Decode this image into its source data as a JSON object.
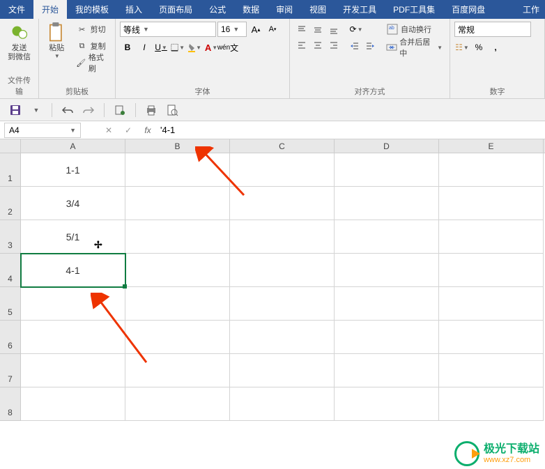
{
  "title": "工作",
  "menu": {
    "items": [
      "文件",
      "开始",
      "我的模板",
      "插入",
      "页面布局",
      "公式",
      "数据",
      "审阅",
      "视图",
      "开发工具",
      "PDF工具集",
      "百度网盘"
    ],
    "active_index": 1
  },
  "ribbon": {
    "group1": {
      "send_wechat": "发送\n到微信",
      "file_transfer": "文件传输"
    },
    "clipboard": {
      "paste": "粘贴",
      "cut": "剪切",
      "copy": "复制",
      "format_painter": "格式刷",
      "label": "剪贴板"
    },
    "font": {
      "name": "等线",
      "size": "16",
      "bold": "B",
      "italic": "I",
      "underline": "U",
      "label": "字体"
    },
    "alignment": {
      "wrap": "自动换行",
      "merge": "合并后居中",
      "label": "对齐方式"
    },
    "number": {
      "format": "常规",
      "label": "数字"
    }
  },
  "qat": {
    "save": "save"
  },
  "formula_bar": {
    "name_box": "A4",
    "formula": "'4-1"
  },
  "columns": [
    "A",
    "B",
    "C",
    "D",
    "E"
  ],
  "rows": [
    {
      "num": "1",
      "cells": [
        "1-1",
        "",
        "",
        "",
        ""
      ]
    },
    {
      "num": "2",
      "cells": [
        "3/4",
        "",
        "",
        "",
        ""
      ]
    },
    {
      "num": "3",
      "cells": [
        "5/1",
        "",
        "",
        "",
        ""
      ]
    },
    {
      "num": "4",
      "cells": [
        "4-1",
        "",
        "",
        "",
        ""
      ]
    },
    {
      "num": "5",
      "cells": [
        "",
        "",
        "",
        "",
        ""
      ]
    },
    {
      "num": "6",
      "cells": [
        "",
        "",
        "",
        "",
        ""
      ]
    },
    {
      "num": "7",
      "cells": [
        "",
        "",
        "",
        "",
        ""
      ]
    },
    {
      "num": "8",
      "cells": [
        "",
        "",
        "",
        "",
        ""
      ]
    }
  ],
  "selected_cell": "A4",
  "watermark": {
    "name": "极光下载站",
    "url": "www.xz7.com"
  }
}
